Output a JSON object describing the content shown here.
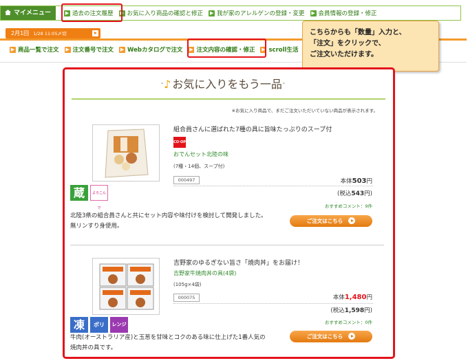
{
  "topbar": {
    "mymenu_label": "マイメニュー",
    "links": [
      "過去の注文履歴",
      "お気に入り商品の確認と修正",
      "我が家のアレルゲンの登録・変更",
      "会員情報の登録・修正"
    ]
  },
  "datebar": {
    "label": "2月1回",
    "time": "1/28 11:05〆切"
  },
  "nav": {
    "links": [
      "商品一覧で注文",
      "注文番号で注文",
      "Webカタログで注文",
      "注文内容の確認・修正",
      "scroll生活"
    ]
  },
  "callout": {
    "line1": "こちらからも「数量」入力と、",
    "line2": "「注文」をクリックで、",
    "line3": "ご注文いただけます。"
  },
  "panel": {
    "heading": "お気に入りをもう一品",
    "note": "※お気に入り商品で、まだご注文いただいていない商品が表示されます。",
    "items": [
      {
        "title": "組合員さんに選ばれた7種の具に旨味たっぷりのスープ付",
        "brand": "CO·OP",
        "name": "おでんセット北陸の味",
        "spec": "(7種・14個、スープ付)",
        "code": "000497",
        "price_prefix": "本体",
        "price": "503",
        "price_suffix": "円",
        "tax_prefix": "(税込",
        "tax_price": "543",
        "tax_suffix": "円)",
        "recommend": "おすすめコメント：9件",
        "badges": [
          "蔵",
          "よろこんで"
        ],
        "desc": "北陸3県の組合員さんと共にセット内容や味付けを検討して開発しました。無リンすり身使用。",
        "order_label": "ご注文はこちら"
      },
      {
        "title": "吉野家のゆるぎない旨さ「焼肉丼」をお届け！",
        "name": "吉野家牛焼肉丼の具(4袋)",
        "spec": "(105g×4袋)",
        "code": "000075",
        "price_prefix": "本体",
        "price": "1,480",
        "price_suffix": "円",
        "tax_prefix": "(税込",
        "tax_price": "1,598",
        "tax_suffix": "円)",
        "recommend": "おすすめコメント：0件",
        "badges": [
          "凍",
          "ポリ",
          "レンジ"
        ],
        "desc": "牛肉(オーストラリア産)と玉葱を甘味とコクのある味に仕上げた1番人気の焼肉丼の具です。",
        "order_label": "ご注文はこちら"
      }
    ]
  },
  "colors": {
    "green": "#4e8f2b",
    "orange": "#f07f13",
    "red": "#e3131b",
    "callout_bg": "#fce4b3"
  }
}
